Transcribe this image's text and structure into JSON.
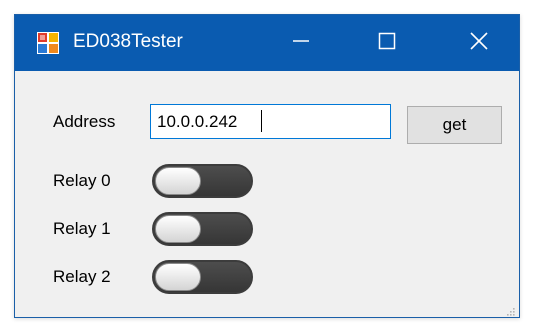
{
  "window": {
    "title": "ED038Tester",
    "controls": {
      "minimize": "minimize-icon",
      "maximize": "maximize-icon",
      "close": "close-icon"
    }
  },
  "address": {
    "label": "Address",
    "value": "10.0.0.242"
  },
  "get_button": {
    "label": "get"
  },
  "relays": [
    {
      "label": "Relay 0",
      "on": false
    },
    {
      "label": "Relay 1",
      "on": false
    },
    {
      "label": "Relay 2",
      "on": false
    }
  ],
  "colors": {
    "titlebar": "#0a5bb0",
    "window_bg": "#f0f0f0",
    "toggle_off": "#3c3c3c",
    "input_focus_border": "#0078d7"
  }
}
